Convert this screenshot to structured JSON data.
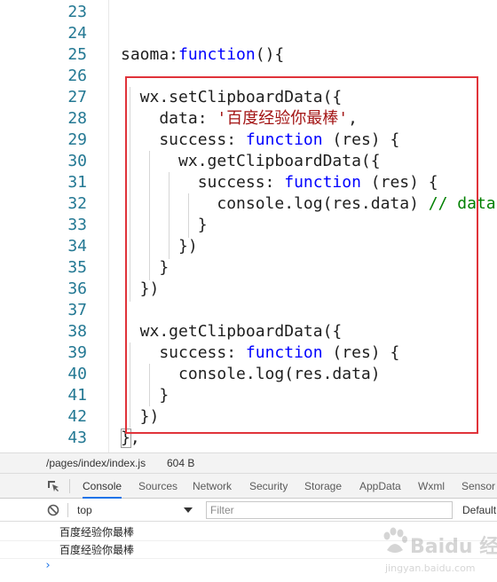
{
  "editor": {
    "line_numbers": [
      "23",
      "24",
      "25",
      "26",
      "27",
      "28",
      "29",
      "30",
      "31",
      "32",
      "33",
      "34",
      "35",
      "36",
      "37",
      "38",
      "39",
      "40",
      "41",
      "42",
      "43"
    ],
    "lines": [
      [],
      [],
      [
        {
          "t": "saoma:",
          "c": "p"
        },
        {
          "t": "function",
          "c": "kw"
        },
        {
          "t": "(){",
          "c": "p"
        }
      ],
      [],
      [
        {
          "t": "  wx.setClipboardData({",
          "c": "p"
        }
      ],
      [
        {
          "t": "    data: ",
          "c": "p"
        },
        {
          "t": "'百度经验你最棒'",
          "c": "str"
        },
        {
          "t": ",",
          "c": "p"
        }
      ],
      [
        {
          "t": "    success: ",
          "c": "p"
        },
        {
          "t": "function",
          "c": "kw"
        },
        {
          "t": " (res) {",
          "c": "p"
        }
      ],
      [
        {
          "t": "      wx.getClipboardData({",
          "c": "p"
        }
      ],
      [
        {
          "t": "        success: ",
          "c": "p"
        },
        {
          "t": "function",
          "c": "kw"
        },
        {
          "t": " (res) {",
          "c": "p"
        }
      ],
      [
        {
          "t": "          console.log(res.data) ",
          "c": "p"
        },
        {
          "t": "// data",
          "c": "cmt"
        }
      ],
      [
        {
          "t": "        }",
          "c": "p"
        }
      ],
      [
        {
          "t": "      })",
          "c": "p"
        }
      ],
      [
        {
          "t": "    }",
          "c": "p"
        }
      ],
      [
        {
          "t": "  })",
          "c": "p"
        }
      ],
      [],
      [
        {
          "t": "  wx.getClipboardData({",
          "c": "p"
        }
      ],
      [
        {
          "t": "    success: ",
          "c": "p"
        },
        {
          "t": "function",
          "c": "kw"
        },
        {
          "t": " (res) {",
          "c": "p"
        }
      ],
      [
        {
          "t": "      console.log(res.data)",
          "c": "p"
        }
      ],
      [
        {
          "t": "    }",
          "c": "p"
        }
      ],
      [
        {
          "t": "  })",
          "c": "p"
        }
      ],
      [
        {
          "t": "},",
          "c": "p"
        }
      ]
    ]
  },
  "filebar": {
    "path": "/pages/index/index.js",
    "size": "604 B"
  },
  "devtools": {
    "tabs": [
      "Console",
      "Sources",
      "Network",
      "Security",
      "Storage",
      "AppData",
      "Wxml",
      "Sensor"
    ],
    "active_tab": "Console",
    "inspect_icon": "inspect-element-icon"
  },
  "console_toolbar": {
    "clear_icon": "block-icon",
    "context_value": "top",
    "filter_placeholder": "Filter",
    "levels_label": "Default"
  },
  "console": {
    "messages": [
      "百度经验你最棒",
      "百度经验你最棒"
    ],
    "prompt": "›"
  },
  "watermark": {
    "text": "Baidu 经验",
    "sub": "jingyan.baidu.com"
  },
  "colors": {
    "highlight_box": "#e0333a",
    "line_number": "#237893",
    "keyword": "#0000ff",
    "string": "#a31515",
    "comment": "#008000",
    "active_tab_underline": "#1a73e8"
  }
}
